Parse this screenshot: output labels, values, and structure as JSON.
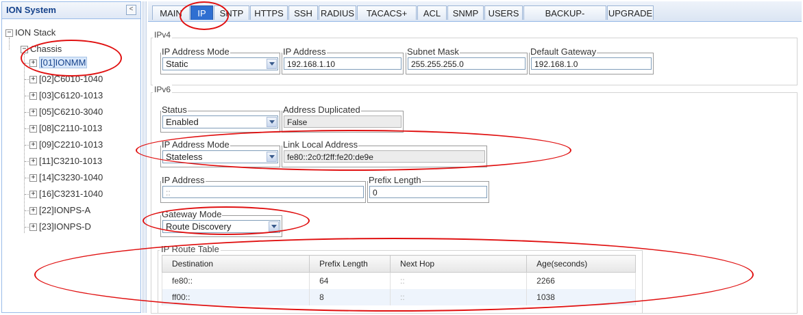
{
  "sidebar": {
    "title": "ION System",
    "collapse_glyph": "<",
    "stack_label": "ION Stack",
    "chassis_label": "Chassis",
    "items": [
      {
        "label": "[01]IONMM"
      },
      {
        "label": "[02]C6010-1040"
      },
      {
        "label": "[03]C6120-1013"
      },
      {
        "label": "[05]C6210-3040"
      },
      {
        "label": "[08]C2110-1013"
      },
      {
        "label": "[09]C2210-1013"
      },
      {
        "label": "[11]C3210-1013"
      },
      {
        "label": "[14]C3230-1040"
      },
      {
        "label": "[16]C3231-1040"
      },
      {
        "label": "[22]IONPS-A"
      },
      {
        "label": "[23]IONPS-D"
      }
    ]
  },
  "tabs": [
    {
      "label": "MAIN"
    },
    {
      "label": "IP"
    },
    {
      "label": "SNTP"
    },
    {
      "label": "HTTPS"
    },
    {
      "label": "SSH"
    },
    {
      "label": "RADIUS"
    },
    {
      "label": "TACACS+"
    },
    {
      "label": "ACL"
    },
    {
      "label": "SNMP"
    },
    {
      "label": "USERS"
    },
    {
      "label": "BACKUP-RESTORE"
    },
    {
      "label": "UPGRADE"
    }
  ],
  "active_tab": "IP",
  "ipv4": {
    "section_title": "IPv4",
    "mode_label": "IP Address Mode",
    "mode_value": "Static",
    "ip_label": "IP Address",
    "ip_value": "192.168.1.10",
    "mask_label": "Subnet Mask",
    "mask_value": "255.255.255.0",
    "gateway_label": "Default Gateway",
    "gateway_value": "192.168.1.0"
  },
  "ipv6": {
    "section_title": "IPv6",
    "status_label": "Status",
    "status_value": "Enabled",
    "dup_label": "Address Duplicated",
    "dup_value": "False",
    "mode_label": "IP Address Mode",
    "mode_value": "Stateless",
    "link_local_label": "Link Local Address",
    "link_local_value": "fe80::2c0:f2ff:fe20:de9e",
    "ip_label": "IP Address",
    "ip_placeholder": "::",
    "prefix_label": "Prefix Length",
    "prefix_value": "0",
    "gateway_mode_label": "Gateway Mode",
    "gateway_mode_value": "Route Discovery"
  },
  "route_table": {
    "title": "IP Route Table",
    "columns": [
      "Destination",
      "Prefix Length",
      "Next Hop",
      "Age(seconds)"
    ],
    "rows": [
      [
        "fe80::",
        "64",
        "::",
        "2266"
      ],
      [
        "ff00::",
        "8",
        "::",
        "1038"
      ]
    ]
  },
  "colors": {
    "active_tab": "#2f6fd1",
    "annotation": "#e01010",
    "panel_border": "#99bbe8"
  },
  "icons": {
    "collapse": "chevron-left-icon",
    "tree_expand": "plus-box-icon",
    "tree_collapse": "minus-box-icon",
    "dropdown": "chevron-down-icon"
  }
}
